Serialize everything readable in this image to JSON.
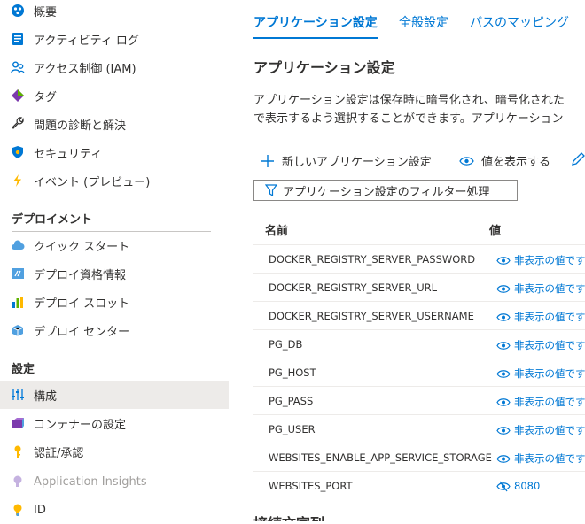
{
  "sidebar": {
    "items_top": [
      {
        "label": "概要",
        "icon": "overview-icon"
      },
      {
        "label": "アクティビティ ログ",
        "icon": "activity-log-icon"
      },
      {
        "label": "アクセス制御 (IAM)",
        "icon": "access-control-icon"
      },
      {
        "label": "タグ",
        "icon": "tag-icon"
      },
      {
        "label": "問題の診断と解決",
        "icon": "wrench-icon"
      },
      {
        "label": "セキュリティ",
        "icon": "shield-icon"
      },
      {
        "label": "イベント (プレビュー)",
        "icon": "lightning-icon"
      }
    ],
    "section_deploy": "デプロイメント",
    "items_deploy": [
      {
        "label": "クイック スタート",
        "icon": "cloud-icon"
      },
      {
        "label": "デプロイ資格情報",
        "icon": "credentials-icon"
      },
      {
        "label": "デプロイ スロット",
        "icon": "slots-icon"
      },
      {
        "label": "デプロイ センター",
        "icon": "deploy-center-icon"
      }
    ],
    "section_settings": "設定",
    "items_settings": [
      {
        "label": "構成",
        "icon": "configuration-icon",
        "selected": true
      },
      {
        "label": "コンテナーの設定",
        "icon": "container-icon"
      },
      {
        "label": "認証/承認",
        "icon": "key-icon"
      },
      {
        "label": "Application Insights",
        "icon": "lightbulb-icon",
        "disabled": true
      },
      {
        "label": "ID",
        "icon": "identity-icon"
      }
    ]
  },
  "tabs": [
    {
      "label": "アプリケーション設定",
      "active": true
    },
    {
      "label": "全般設定"
    },
    {
      "label": "パスのマッピング"
    }
  ],
  "main": {
    "heading": "アプリケーション設定",
    "desc_line1": "アプリケーション設定は保存時に暗号化され、暗号化された",
    "desc_line2": "で表示するよう選択することができます。アプリケーション",
    "new_setting": "新しいアプリケーション設定",
    "show_values": "値を表示する",
    "filter_placeholder": "アプリケーション設定のフィルター処理",
    "col_name": "名前",
    "col_value": "値",
    "next_section": "接続文字列"
  },
  "settings": [
    {
      "name": "DOCKER_REGISTRY_SERVER_PASSWORD",
      "value": "非表示の値です",
      "hidden": true
    },
    {
      "name": "DOCKER_REGISTRY_SERVER_URL",
      "value": "非表示の値です",
      "hidden": true
    },
    {
      "name": "DOCKER_REGISTRY_SERVER_USERNAME",
      "value": "非表示の値です",
      "hidden": true
    },
    {
      "name": "PG_DB",
      "value": "非表示の値です",
      "hidden": true
    },
    {
      "name": "PG_HOST",
      "value": "非表示の値です",
      "hidden": true
    },
    {
      "name": "PG_PASS",
      "value": "非表示の値です",
      "hidden": true
    },
    {
      "name": "PG_USER",
      "value": "非表示の値です",
      "hidden": true
    },
    {
      "name": "WEBSITES_ENABLE_APP_SERVICE_STORAGE",
      "value": "非表示の値です",
      "hidden": true
    },
    {
      "name": "WEBSITES_PORT",
      "value": "8080",
      "hidden": false
    }
  ],
  "colors": {
    "accent": "#0078d4",
    "selected_bg": "#edebe9",
    "text": "#323130"
  }
}
